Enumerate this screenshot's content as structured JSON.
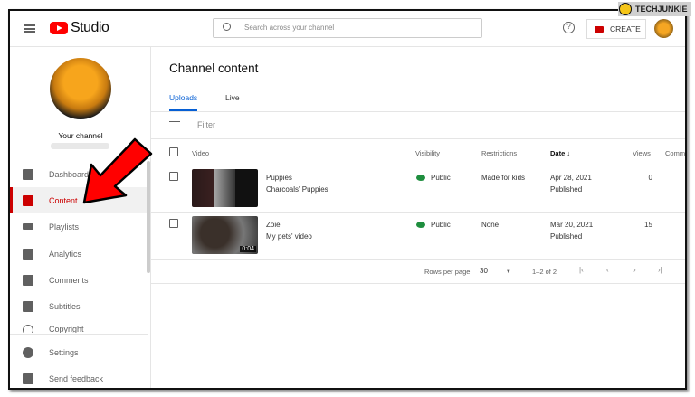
{
  "watermark": "TECHJUNKIE",
  "header": {
    "logo_text": "Studio",
    "search_placeholder": "Search across your channel",
    "create_label": "CREATE"
  },
  "sidebar": {
    "channel_label": "Your channel",
    "items": [
      {
        "label": "Dashboard"
      },
      {
        "label": "Content"
      },
      {
        "label": "Playlists"
      },
      {
        "label": "Analytics"
      },
      {
        "label": "Comments"
      },
      {
        "label": "Subtitles"
      },
      {
        "label": "Copyright"
      }
    ],
    "bottom": [
      {
        "label": "Settings"
      },
      {
        "label": "Send feedback"
      }
    ]
  },
  "main": {
    "title": "Channel content",
    "tabs": [
      {
        "label": "Uploads"
      },
      {
        "label": "Live"
      }
    ],
    "filter_label": "Filter",
    "columns": {
      "video": "Video",
      "visibility": "Visibility",
      "restrictions": "Restrictions",
      "date": "Date",
      "views": "Views",
      "comments": "Comm"
    },
    "rows": [
      {
        "title": "Puppies",
        "description": "Charcoals' Puppies",
        "visibility": "Public",
        "restrictions": "Made for kids",
        "date": "Apr 28, 2021",
        "status": "Published",
        "views": "0",
        "duration": ""
      },
      {
        "title": "Zoie",
        "description": "My pets' video",
        "visibility": "Public",
        "restrictions": "None",
        "date": "Mar 20, 2021",
        "status": "Published",
        "views": "15",
        "duration": "0:04"
      }
    ],
    "pagination": {
      "rows_per_page_label": "Rows per page:",
      "rows_per_page": "30",
      "range": "1–2 of 2"
    }
  },
  "colors": {
    "accent": "#cc0000",
    "tab": "#065fd4",
    "public": "#1e8e3e"
  }
}
